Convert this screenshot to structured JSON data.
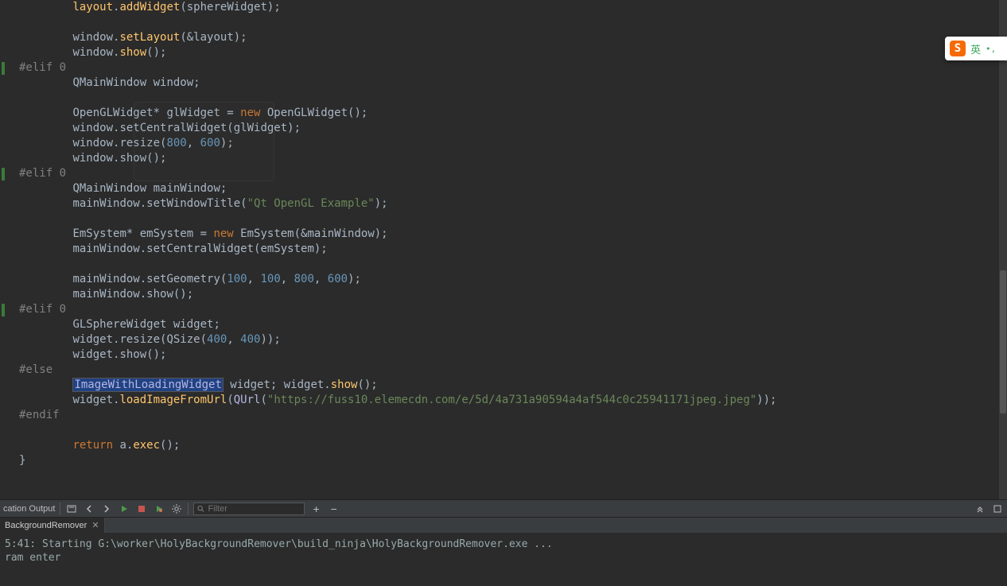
{
  "code_lines": [
    {
      "indent": 8,
      "tokens": [
        {
          "t": "fn",
          "v": "layout"
        },
        {
          "t": "plain",
          "v": "."
        },
        {
          "t": "fn",
          "v": "addWidget"
        },
        {
          "t": "plain",
          "v": "(sphereWidget);"
        }
      ]
    },
    {
      "indent": 0,
      "tokens": []
    },
    {
      "indent": 8,
      "tokens": [
        {
          "t": "plain",
          "v": "window."
        },
        {
          "t": "fn",
          "v": "setLayout"
        },
        {
          "t": "plain",
          "v": "(&layout);"
        }
      ]
    },
    {
      "indent": 8,
      "tokens": [
        {
          "t": "plain",
          "v": "window."
        },
        {
          "t": "fn",
          "v": "show"
        },
        {
          "t": "plain",
          "v": "();"
        }
      ]
    },
    {
      "indent": 0,
      "tokens": [
        {
          "t": "preproc",
          "v": "#elif 0"
        }
      ],
      "mark": true
    },
    {
      "indent": 8,
      "tokens": [
        {
          "t": "type",
          "v": "QMainWindow window;"
        }
      ]
    },
    {
      "indent": 0,
      "tokens": []
    },
    {
      "indent": 8,
      "tokens": [
        {
          "t": "type",
          "v": "OpenGLWidget* glWidget = "
        },
        {
          "t": "keyword",
          "v": "new"
        },
        {
          "t": "type",
          "v": " OpenGLWidget();"
        }
      ]
    },
    {
      "indent": 8,
      "tokens": [
        {
          "t": "type",
          "v": "window.setCentralWidget(glWidget);"
        }
      ]
    },
    {
      "indent": 8,
      "tokens": [
        {
          "t": "type",
          "v": "window.resize("
        },
        {
          "t": "number",
          "v": "800"
        },
        {
          "t": "type",
          "v": ", "
        },
        {
          "t": "number",
          "v": "600"
        },
        {
          "t": "type",
          "v": ");"
        }
      ]
    },
    {
      "indent": 8,
      "tokens": [
        {
          "t": "type",
          "v": "window.show();"
        }
      ]
    },
    {
      "indent": 0,
      "tokens": [
        {
          "t": "preproc",
          "v": "#elif 0"
        }
      ],
      "mark": true
    },
    {
      "indent": 8,
      "tokens": [
        {
          "t": "type",
          "v": "QMainWindow mainWindow;"
        }
      ]
    },
    {
      "indent": 8,
      "tokens": [
        {
          "t": "type",
          "v": "mainWindow.setWindowTitle("
        },
        {
          "t": "string",
          "v": "\"Qt OpenGL Example\""
        },
        {
          "t": "type",
          "v": ");"
        }
      ]
    },
    {
      "indent": 0,
      "tokens": []
    },
    {
      "indent": 8,
      "tokens": [
        {
          "t": "type",
          "v": "EmSystem* emSystem = "
        },
        {
          "t": "keyword",
          "v": "new"
        },
        {
          "t": "type",
          "v": " EmSystem(&mainWindow);"
        }
      ]
    },
    {
      "indent": 8,
      "tokens": [
        {
          "t": "type",
          "v": "mainWindow.setCentralWidget(emSystem);"
        }
      ]
    },
    {
      "indent": 0,
      "tokens": []
    },
    {
      "indent": 8,
      "tokens": [
        {
          "t": "type",
          "v": "mainWindow.setGeometry("
        },
        {
          "t": "number",
          "v": "100"
        },
        {
          "t": "type",
          "v": ", "
        },
        {
          "t": "number",
          "v": "100"
        },
        {
          "t": "type",
          "v": ", "
        },
        {
          "t": "number",
          "v": "800"
        },
        {
          "t": "type",
          "v": ", "
        },
        {
          "t": "number",
          "v": "600"
        },
        {
          "t": "type",
          "v": ");"
        }
      ]
    },
    {
      "indent": 8,
      "tokens": [
        {
          "t": "type",
          "v": "mainWindow.show();"
        }
      ]
    },
    {
      "indent": 0,
      "tokens": [
        {
          "t": "preproc",
          "v": "#elif 0"
        }
      ],
      "mark": true
    },
    {
      "indent": 8,
      "tokens": [
        {
          "t": "type",
          "v": "GLSphereWidget widget;"
        }
      ]
    },
    {
      "indent": 8,
      "tokens": [
        {
          "t": "type",
          "v": "widget.resize(QSize("
        },
        {
          "t": "number",
          "v": "400"
        },
        {
          "t": "type",
          "v": ", "
        },
        {
          "t": "number",
          "v": "400"
        },
        {
          "t": "type",
          "v": "));"
        }
      ]
    },
    {
      "indent": 8,
      "tokens": [
        {
          "t": "type",
          "v": "widget.show();"
        }
      ]
    },
    {
      "indent": 0,
      "tokens": [
        {
          "t": "preproc",
          "v": "#else"
        }
      ]
    },
    {
      "indent": 8,
      "tokens": [
        {
          "t": "sel",
          "v": "ImageWithLoadingWidget"
        },
        {
          "t": "plain",
          "v": " widget; widget."
        },
        {
          "t": "fn",
          "v": "show"
        },
        {
          "t": "plain",
          "v": "();"
        }
      ]
    },
    {
      "indent": 8,
      "tokens": [
        {
          "t": "plain",
          "v": "widget."
        },
        {
          "t": "fn",
          "v": "loadImageFromUrl"
        },
        {
          "t": "plain",
          "v": "("
        },
        {
          "t": "class",
          "v": "QUrl"
        },
        {
          "t": "plain",
          "v": "("
        },
        {
          "t": "string",
          "v": "\"https://fuss10.elemecdn.com/e/5d/4a731a90594a4af544c0c25941171jpeg.jpeg\""
        },
        {
          "t": "plain",
          "v": "));"
        }
      ]
    },
    {
      "indent": 0,
      "tokens": [
        {
          "t": "preproc",
          "v": "#endif"
        }
      ]
    },
    {
      "indent": 0,
      "tokens": []
    },
    {
      "indent": 8,
      "tokens": [
        {
          "t": "keyword",
          "v": "return"
        },
        {
          "t": "plain",
          "v": " a."
        },
        {
          "t": "fn",
          "v": "exec"
        },
        {
          "t": "plain",
          "v": "();"
        }
      ]
    },
    {
      "indent": 0,
      "tokens": [
        {
          "t": "plain",
          "v": "}"
        }
      ]
    }
  ],
  "panel": {
    "label": "cation Output",
    "filter_placeholder": "Filter"
  },
  "tab": {
    "name": "BackgroundRemover"
  },
  "output_lines": [
    "5:41: Starting G:\\worker\\HolyBackgroundRemover\\build_ninja\\HolyBackgroundRemover.exe ...",
    "ram enter"
  ],
  "ime": {
    "logo": "S",
    "lang": "英"
  }
}
